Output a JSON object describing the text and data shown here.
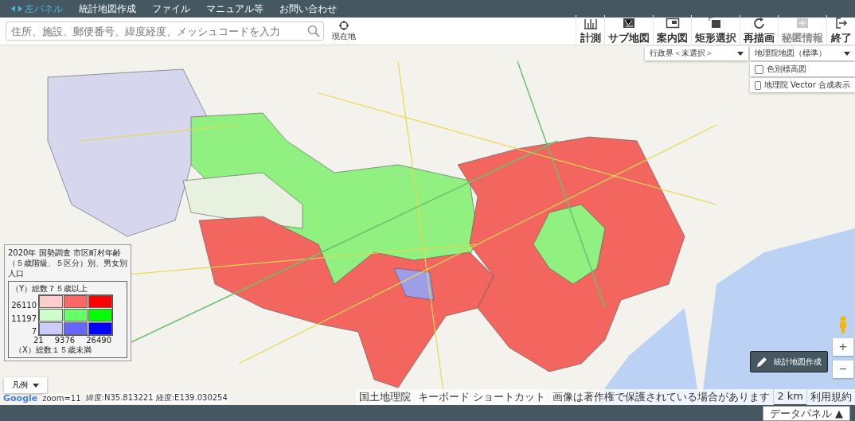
{
  "menu_bar": {
    "panel_toggle": {
      "label": "左パネル",
      "selected": true
    },
    "items": [
      "統計地図作成",
      "ファイル",
      "マニュアル等",
      "お問い合わせ"
    ]
  },
  "search": {
    "placeholder": "住所、施設、郵便番号、緯度経度、メッシュコードを入力"
  },
  "location_button": {
    "label": "現在地"
  },
  "tools": [
    {
      "kind": "ruler",
      "label": "計測",
      "disabled": false
    },
    {
      "kind": "submap",
      "label": "サブ地図",
      "disabled": false
    },
    {
      "kind": "window",
      "label": "案内図",
      "disabled": false
    },
    {
      "kind": "select",
      "label": "矩形選択",
      "disabled": false
    },
    {
      "kind": "refresh",
      "label": "再描画",
      "disabled": false
    },
    {
      "kind": "secret",
      "label": "秘匿情報",
      "disabled": true
    },
    {
      "kind": "exit",
      "label": "終了",
      "disabled": false
    }
  ],
  "boundary_dropdown": {
    "value": "行政界＜未選択＞"
  },
  "base_map_dropdown": {
    "value": "地理院地図（標準）"
  },
  "layer_options": [
    {
      "label": "色別標高図",
      "checked": false
    },
    {
      "label": "地理院 Vector 合成表示",
      "checked": false
    }
  ],
  "legend": {
    "title": "2020年 国勢調査 市区町村年齢（５歳階級、５区分）別、男女別人口",
    "y_label": "（Y）総数７５歳以上",
    "y_ticks": [
      "26110",
      "11197",
      "7"
    ],
    "x_ticks": [
      "21",
      "9376",
      "26490"
    ],
    "x_label": "（X）総数１５歳未満",
    "cells": [
      {
        "color": "#ffcccc"
      },
      {
        "color": "#ff6666"
      },
      {
        "color": "#ff0000"
      },
      {
        "color": "#ccffcc"
      },
      {
        "color": "#66ff66"
      },
      {
        "color": "#00ff00"
      },
      {
        "color": "#ccccff"
      },
      {
        "color": "#6666ff"
      },
      {
        "color": "#0000ff"
      }
    ]
  },
  "legend_toggle": {
    "label": "凡例",
    "expanded": true
  },
  "map_info": {
    "logo": "Google",
    "zoom": "zoom=11",
    "coords": "緯度:N35.813221 経度:E139.030254"
  },
  "attribution": [
    "国土地理院",
    "キーボード ショートカット",
    "画像は著作権で保護されている場合があります",
    "2 km",
    "利用規約"
  ],
  "create_map_button": {
    "label": "統計地図作成"
  },
  "zoom_controls": [
    "+",
    "−"
  ],
  "data_panel_button": {
    "label": "データパネル ▲"
  }
}
